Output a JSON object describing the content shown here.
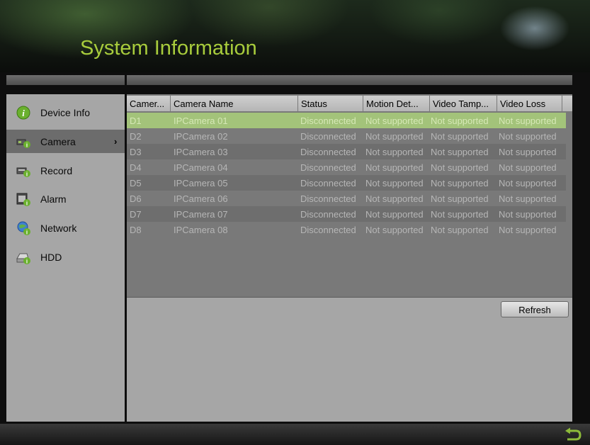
{
  "title": "System Information",
  "sidebar": {
    "items": [
      {
        "label": "Device Info",
        "icon": "info-icon"
      },
      {
        "label": "Camera",
        "icon": "camera-icon"
      },
      {
        "label": "Record",
        "icon": "record-icon"
      },
      {
        "label": "Alarm",
        "icon": "alarm-icon"
      },
      {
        "label": "Network",
        "icon": "network-icon"
      },
      {
        "label": "HDD",
        "icon": "hdd-icon"
      }
    ],
    "selected": "Camera",
    "chevron": "›"
  },
  "table": {
    "columns": [
      "Camer...",
      "Camera Name",
      "Status",
      "Motion Det...",
      "Video Tamp...",
      "Video Loss"
    ],
    "rows": [
      {
        "cam": "D1",
        "name": "IPCamera 01",
        "status": "Disconnected",
        "motion": "Not supported",
        "tamper": "Not supported",
        "loss": "Not supported"
      },
      {
        "cam": "D2",
        "name": "IPCamera 02",
        "status": "Disconnected",
        "motion": "Not supported",
        "tamper": "Not supported",
        "loss": "Not supported"
      },
      {
        "cam": "D3",
        "name": "IPCamera 03",
        "status": "Disconnected",
        "motion": "Not supported",
        "tamper": "Not supported",
        "loss": "Not supported"
      },
      {
        "cam": "D4",
        "name": "IPCamera 04",
        "status": "Disconnected",
        "motion": "Not supported",
        "tamper": "Not supported",
        "loss": "Not supported"
      },
      {
        "cam": "D5",
        "name": "IPCamera 05",
        "status": "Disconnected",
        "motion": "Not supported",
        "tamper": "Not supported",
        "loss": "Not supported"
      },
      {
        "cam": "D6",
        "name": "IPCamera 06",
        "status": "Disconnected",
        "motion": "Not supported",
        "tamper": "Not supported",
        "loss": "Not supported"
      },
      {
        "cam": "D7",
        "name": "IPCamera 07",
        "status": "Disconnected",
        "motion": "Not supported",
        "tamper": "Not supported",
        "loss": "Not supported"
      },
      {
        "cam": "D8",
        "name": "IPCamera 08",
        "status": "Disconnected",
        "motion": "Not supported",
        "tamper": "Not supported",
        "loss": "Not supported"
      }
    ]
  },
  "refresh_label": "Refresh",
  "back_icon": "return-arrow-icon",
  "colors": {
    "title": "#a8cc3c",
    "selected_row": "#a3c37a"
  }
}
